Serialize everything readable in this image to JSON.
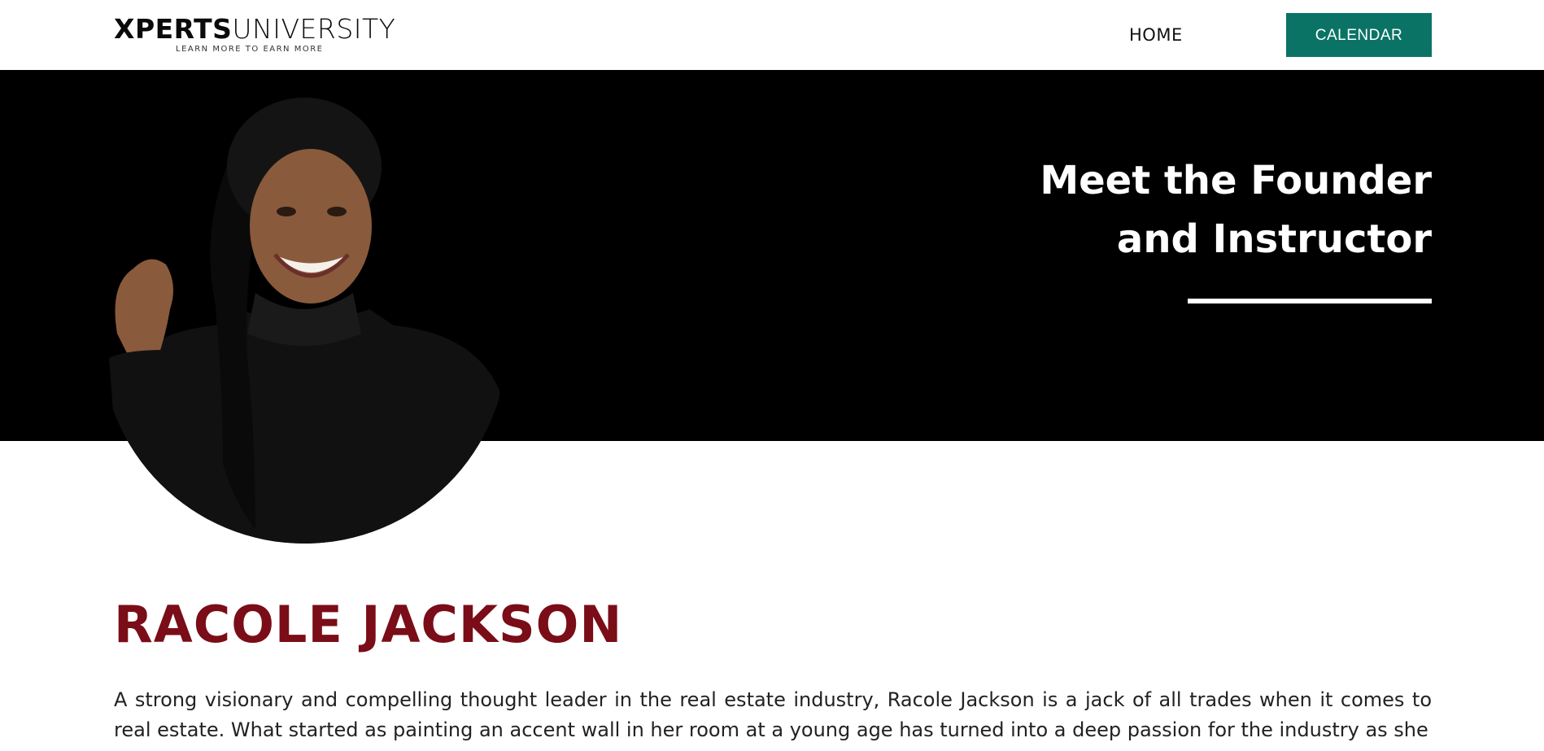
{
  "header": {
    "logo": {
      "brand_bold": "XPERTS",
      "brand_light": "UNIVERSITY",
      "tagline": "LEARN MORE TO EARN MORE"
    },
    "nav": {
      "home_label": "HOME",
      "calendar_label": "CALENDAR"
    }
  },
  "hero": {
    "heading_line1": "Meet the Founder",
    "heading_line2": "and Instructor",
    "portrait_icon": "person-photo"
  },
  "bio": {
    "name": "RACOLE JACKSON",
    "paragraph": "A strong visionary and compelling thought leader in the real estate industry, Racole Jackson is a jack of all trades when it comes to real estate. What started as painting an accent wall in her room at a young age has turned into a deep passion for the industry as she"
  },
  "colors": {
    "accent_teal": "#0b7365",
    "name_maroon": "#7a0d17",
    "hero_background": "#000000"
  }
}
